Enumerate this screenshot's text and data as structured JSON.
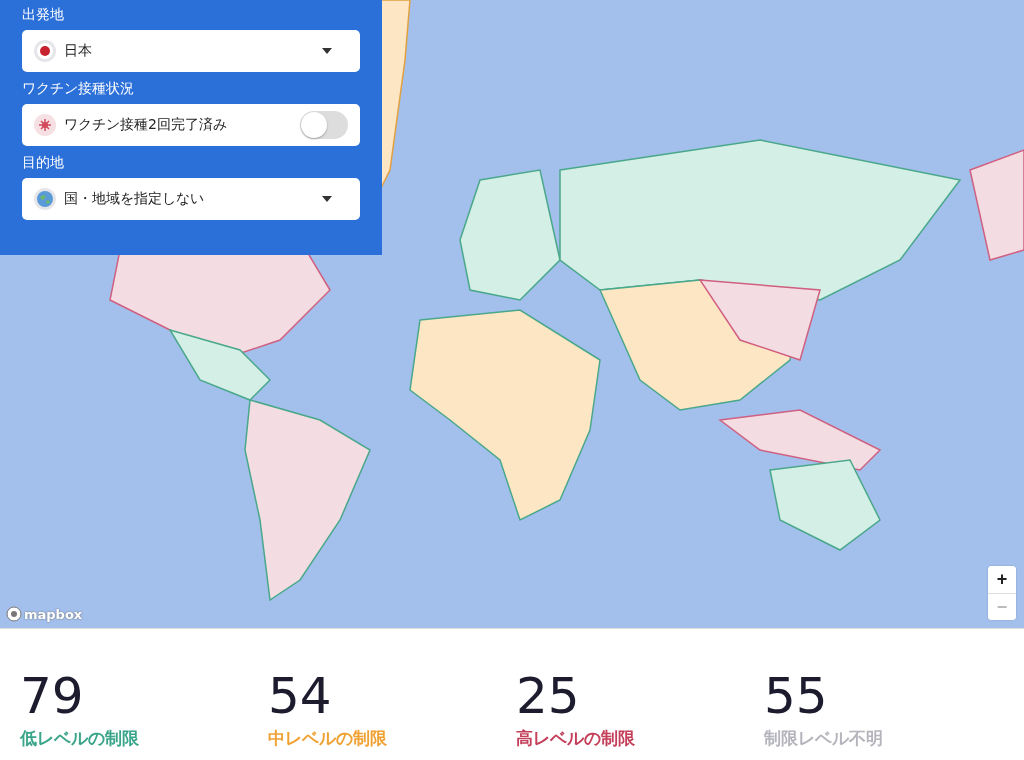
{
  "panel": {
    "fields": [
      {
        "kind": "select",
        "label": "出発地",
        "value": "日本"
      },
      {
        "kind": "toggle",
        "label": "ワクチン接種状況",
        "value": "ワクチン接種2回完了済み",
        "on": false
      },
      {
        "kind": "select",
        "label": "目的地",
        "value": "国・地域を指定しない"
      }
    ]
  },
  "map": {
    "attribution": "mapbox",
    "zoom_in": "+",
    "zoom_out": "−"
  },
  "stats": [
    {
      "count": "79",
      "label": "低レベルの制限",
      "color": "#3aa58a"
    },
    {
      "count": "54",
      "label": "中レベルの制限",
      "color": "#efa233"
    },
    {
      "count": "25",
      "label": "高レベルの制限",
      "color": "#c4405a"
    },
    {
      "count": "55",
      "label": "制限レベル不明",
      "color": "#b4b4bc"
    }
  ]
}
